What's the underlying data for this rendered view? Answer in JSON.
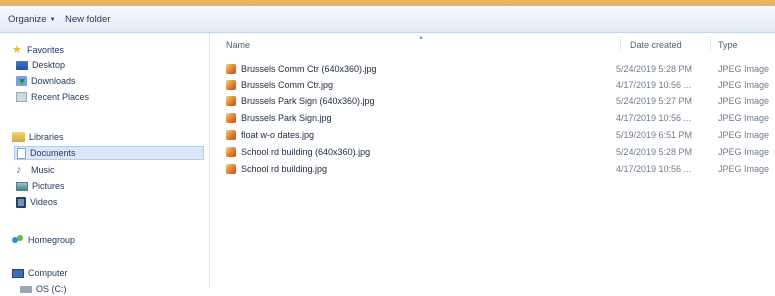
{
  "toolbar": {
    "organize": "Organize",
    "new_folder": "New folder"
  },
  "nav": {
    "favorites": "Favorites",
    "desktop": "Desktop",
    "downloads": "Downloads",
    "recent_places": "Recent Places",
    "libraries": "Libraries",
    "documents": "Documents",
    "music": "Music",
    "pictures": "Pictures",
    "videos": "Videos",
    "homegroup": "Homegroup",
    "computer": "Computer",
    "os_drive": "OS (C:)"
  },
  "columns": {
    "name": "Name",
    "date_created": "Date created",
    "type": "Type"
  },
  "files": [
    {
      "name": "Brussels Comm  Ctr (640x360).jpg",
      "date": "5/24/2019 5:28 PM",
      "type": "JPEG Image"
    },
    {
      "name": "Brussels Comm  Ctr.jpg",
      "date": "4/17/2019 10:56 ...",
      "type": "JPEG Image"
    },
    {
      "name": "Brussels Park Sign (640x360).jpg",
      "date": "5/24/2019 5:27 PM",
      "type": "JPEG Image"
    },
    {
      "name": "Brussels Park Sign.jpg",
      "date": "4/17/2019 10:56 ...",
      "type": "JPEG Image"
    },
    {
      "name": "float w-o dates.jpg",
      "date": "5/19/2019 6:51 PM",
      "type": "JPEG Image"
    },
    {
      "name": "School rd building (640x360).jpg",
      "date": "5/24/2019 5:28 PM",
      "type": "JPEG Image"
    },
    {
      "name": "School rd building.jpg",
      "date": "4/17/2019 10:56 ...",
      "type": "JPEG Image"
    }
  ]
}
